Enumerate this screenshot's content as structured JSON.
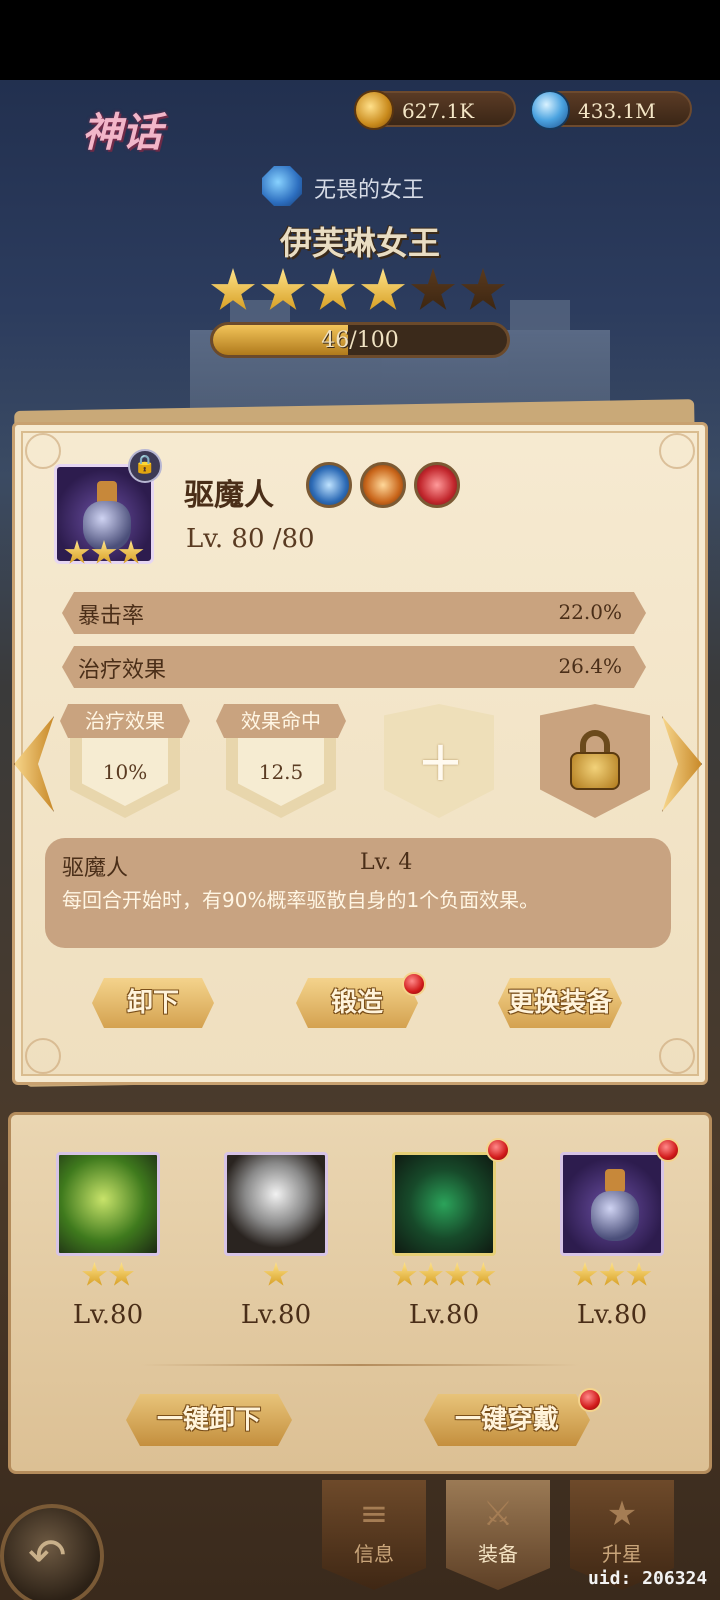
{
  "header": {
    "rarity_title": "神话",
    "gold_value": "627.1K",
    "gem_value": "433.1M",
    "hero_subtitle": "无畏的女王",
    "hero_name": "伊芙琳女王",
    "stars_filled": 4,
    "stars_total": 6,
    "shard_progress_text": "46/100",
    "shard_progress_fraction": 0.46
  },
  "item": {
    "name": "驱魔人",
    "level": "Lv. 80 /80",
    "stars": 3,
    "attribute_icons": [
      "blue-emblem-icon",
      "fire-spear-icon",
      "red-shield-icon"
    ],
    "stats": [
      {
        "name": "暴击率",
        "value": "22.0%"
      },
      {
        "name": "治疗效果",
        "value": "26.4%"
      }
    ],
    "gem_slots": [
      {
        "label": "治疗效果",
        "value": "10%"
      },
      {
        "label": "效果命中",
        "value": "12.5"
      },
      {
        "state": "empty"
      },
      {
        "state": "locked"
      }
    ],
    "skill": {
      "name": "驱魔人",
      "level": "Lv. 4",
      "description": "每回合开始时，有90%概率驱散自身的1个负面效果。"
    },
    "buttons": {
      "unequip": "卸下",
      "forge": "锻造",
      "change": "更换装备"
    }
  },
  "equipment": [
    {
      "stars": 2,
      "level": "Lv.80"
    },
    {
      "stars": 1,
      "level": "Lv.80"
    },
    {
      "stars": 4,
      "level": "Lv.80"
    },
    {
      "stars": 3,
      "level": "Lv.80"
    }
  ],
  "bulk_buttons": {
    "unequip_all": "一键卸下",
    "equip_all": "一键穿戴"
  },
  "nav": {
    "info": "信息",
    "equip": "装备",
    "star_up": "升星"
  },
  "uid": "uid: 206324",
  "colors": {
    "panel_bg": "#f6ead1",
    "stat_bar": "#c9a37f",
    "button_gold": "#f4d38c",
    "red_dot": "#d11a1a"
  }
}
